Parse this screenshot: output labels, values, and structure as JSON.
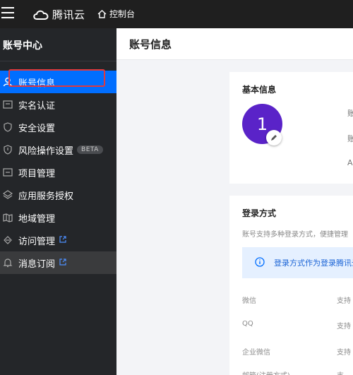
{
  "topbar": {
    "brand": "腾讯云",
    "console_label": "控制台"
  },
  "sidebar": {
    "title": "账号中心",
    "items": [
      {
        "label": "账号信息",
        "icon": "user-icon",
        "active": true
      },
      {
        "label": "实名认证",
        "icon": "id-card-icon"
      },
      {
        "label": "安全设置",
        "icon": "shield-icon"
      },
      {
        "label": "风险操作设置",
        "icon": "shield-alert-icon",
        "badge": "BETA"
      },
      {
        "label": "项目管理",
        "icon": "folder-icon"
      },
      {
        "label": "应用服务授权",
        "icon": "layers-icon"
      },
      {
        "label": "地域管理",
        "icon": "map-icon"
      },
      {
        "label": "访问管理",
        "icon": "access-icon",
        "external": true
      },
      {
        "label": "消息订阅",
        "icon": "bell-icon",
        "external": true
      }
    ]
  },
  "main": {
    "title": "账号信息",
    "basic_info": {
      "title": "基本信息",
      "avatar_text": "1",
      "truncated": [
        "账",
        "账",
        "A"
      ]
    },
    "login_methods": {
      "title": "登录方式",
      "description": "账号支持多种登录方式，便捷管理",
      "notice": "登录方式作为登录腾讯云",
      "rows": [
        {
          "label": "微信",
          "value": "支持"
        },
        {
          "label": "QQ",
          "value": "支持"
        },
        {
          "label": "企业微信",
          "value": "支持"
        },
        {
          "label": "邮箱(注册方式)",
          "value": "支"
        }
      ]
    }
  },
  "colors": {
    "accent": "#006eff",
    "avatar": "#5a23c8",
    "highlight_box": "#e0393e"
  }
}
